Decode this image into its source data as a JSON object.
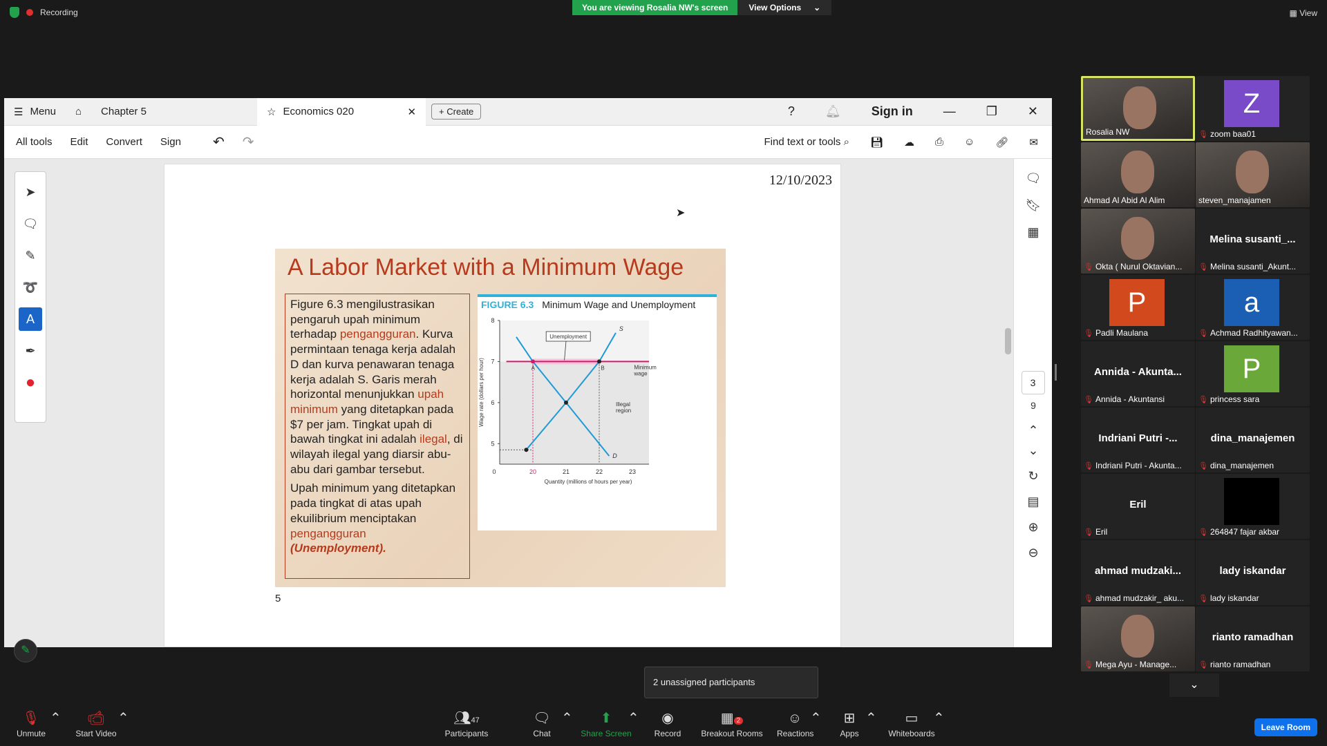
{
  "top": {
    "recording": "Recording",
    "viewing": "You are viewing Rosalia NW's screen",
    "view_options": "View Options",
    "view": "View"
  },
  "acrobat": {
    "menu": "Menu",
    "tab1": "Chapter 5",
    "tab2": "Economics 020",
    "create": "Create",
    "sign_in": "Sign in",
    "toolbar": [
      "All tools",
      "Edit",
      "Convert",
      "Sign"
    ],
    "find": "Find text or tools",
    "page_num": "3",
    "page_total": "9",
    "date": "12/10/2023",
    "page_label": "5"
  },
  "slide": {
    "title": "A Labor Market with a Minimum Wage",
    "p1a": "Figure 6.3 mengilustrasikan pengaruh upah minimum terhadap ",
    "p1b": "pengangguran",
    "p1c": ". Kurva permintaan tenaga kerja adalah D dan kurva penawaran tenaga kerja adalah S. Garis merah horizontal menunjukkan ",
    "p1d": "upah minimum",
    "p1e": " yang ditetapkan pada $7 per jam. Tingkat upah di bawah tingkat ini adalah ",
    "p1f": "ilegal",
    "p1g": ", di wilayah ilegal yang diarsir abu-abu dari gambar tersebut.",
    "p2a": "Upah minimum yang ditetapkan pada tingkat di atas upah ekuilibrium menciptakan ",
    "p2b": "pengangguran",
    "p2c": "(Unemployment).",
    "fig_num": "FIGURE 6.3",
    "fig_title": "Minimum Wage and Unemployment",
    "ylabel": "Wage rate (dollars per hour)",
    "xlabel": "Quantity (millions of hours per year)",
    "unemployment": "Unemployment",
    "min_wage": "Minimum wage",
    "illegal": "Illegal region",
    "S": "S",
    "D": "D",
    "A": "A",
    "B": "B"
  },
  "chart_data": {
    "type": "line",
    "title": "Minimum Wage and Unemployment",
    "xlabel": "Quantity (millions of hours per year)",
    "ylabel": "Wage rate (dollars per hour)",
    "x_ticks": [
      "0",
      "20",
      "21",
      "22",
      "23"
    ],
    "y_ticks": [
      "5",
      "6",
      "7",
      "8"
    ],
    "series": [
      {
        "name": "S",
        "points": [
          [
            19.8,
            4.85
          ],
          [
            21,
            6
          ],
          [
            22,
            7
          ],
          [
            22.5,
            7.7
          ]
        ]
      },
      {
        "name": "D",
        "points": [
          [
            19.5,
            7.6
          ],
          [
            20,
            7
          ],
          [
            21,
            6
          ],
          [
            22.3,
            4.7
          ]
        ]
      },
      {
        "name": "Minimum wage",
        "points": [
          [
            19.2,
            7
          ],
          [
            23.5,
            7
          ]
        ]
      }
    ],
    "points": [
      {
        "label": "A",
        "x": 20,
        "y": 7
      },
      {
        "label": "B",
        "x": 22,
        "y": 7
      }
    ],
    "xlim": [
      19,
      23.5
    ],
    "ylim": [
      4.5,
      8
    ]
  },
  "participants": [
    {
      "name": "Rosalia NW",
      "type": "video",
      "muted": false
    },
    {
      "name": "zoom baa01",
      "type": "avatar",
      "letter": "Z",
      "color": "#7a4bc9",
      "muted": true
    },
    {
      "name": "Ahmad Al Abid Al Alim",
      "type": "video",
      "muted": false
    },
    {
      "name": "steven_manajamen",
      "type": "video",
      "muted": false
    },
    {
      "name": "Okta ( Nurul Oktavian...",
      "type": "video",
      "muted": true
    },
    {
      "name": "Melina susanti_Akunt...",
      "type": "name",
      "big": "Melina susanti_...",
      "muted": true
    },
    {
      "name": "Padli Maulana",
      "type": "avatar",
      "letter": "P",
      "color": "#d1491d",
      "muted": true
    },
    {
      "name": "Achmad Radhityawan...",
      "type": "avatar",
      "letter": "a",
      "color": "#1a5fb4",
      "muted": true
    },
    {
      "name": "Annida - Akuntansi",
      "type": "name",
      "big": "Annida - Akunta...",
      "muted": true
    },
    {
      "name": "princess sara",
      "type": "avatar",
      "letter": "P",
      "color": "#6aa839",
      "muted": true
    },
    {
      "name": "Indriani Putri - Akunta...",
      "type": "name",
      "big": "Indriani Putri -...",
      "muted": true
    },
    {
      "name": "dina_manajemen",
      "type": "name",
      "big": "dina_manajemen",
      "muted": true
    },
    {
      "name": "Eril",
      "type": "name",
      "big": "Eril",
      "muted": true
    },
    {
      "name": "264847 fajar akbar",
      "type": "black",
      "muted": true
    },
    {
      "name": "ahmad mudzakir_ aku...",
      "type": "name",
      "big": "ahmad mudzaki...",
      "muted": true
    },
    {
      "name": "lady iskandar",
      "type": "name",
      "big": "lady iskandar",
      "muted": true
    },
    {
      "name": "Mega Ayu - Manage...",
      "type": "video",
      "muted": true
    },
    {
      "name": "rianto ramadhan",
      "type": "name",
      "big": "rianto ramadhan",
      "muted": true
    }
  ],
  "bottom": {
    "unmute": "Unmute",
    "start_video": "Start Video",
    "participants": "Participants",
    "participants_count": "47",
    "chat": "Chat",
    "share": "Share Screen",
    "record": "Record",
    "breakout": "Breakout Rooms",
    "breakout_badge": "2",
    "reactions": "Reactions",
    "apps": "Apps",
    "whiteboards": "Whiteboards",
    "leave": "Leave Room",
    "tooltip": "2 unassigned participants"
  }
}
